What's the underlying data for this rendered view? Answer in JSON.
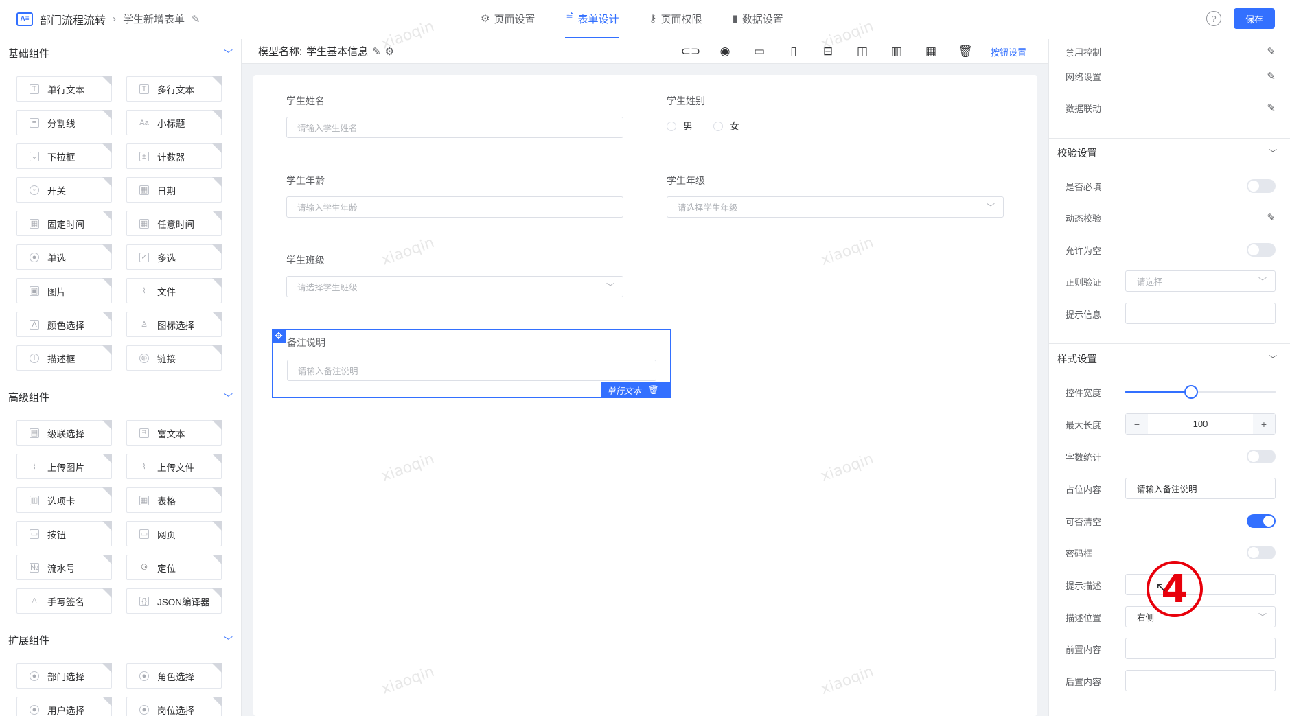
{
  "header": {
    "breadcrumb_root": "部门流程流转",
    "breadcrumb_page": "学生新增表单",
    "tabs": [
      {
        "label": "页面设置",
        "icon": "gear-icon",
        "active": false
      },
      {
        "label": "表单设计",
        "icon": "document-icon",
        "active": true
      },
      {
        "label": "页面权限",
        "icon": "lock-icon",
        "active": false
      },
      {
        "label": "数据设置",
        "icon": "bar-chart-icon",
        "active": false
      }
    ],
    "save_label": "保存"
  },
  "left_panel": {
    "groups": [
      {
        "title": "基础组件",
        "items": [
          "单行文本",
          "多行文本",
          "分割线",
          "小标题",
          "下拉框",
          "计数器",
          "开关",
          "日期",
          "固定时间",
          "任意时间",
          "单选",
          "多选",
          "图片",
          "文件",
          "颜色选择",
          "图标选择",
          "描述框",
          "链接"
        ]
      },
      {
        "title": "高级组件",
        "items": [
          "级联选择",
          "富文本",
          "上传图片",
          "上传文件",
          "选项卡",
          "表格",
          "按钮",
          "网页",
          "流水号",
          "定位",
          "手写签名",
          "JSON编译器"
        ]
      },
      {
        "title": "扩展组件",
        "items": [
          "部门选择",
          "角色选择",
          "用户选择",
          "岗位选择"
        ]
      }
    ]
  },
  "center": {
    "model_label": "模型名称:",
    "model_name": "学生基本信息",
    "button_settings": "按钮设置",
    "toolbar_icons": [
      "link-icon",
      "eye-icon",
      "pc-layout-icon",
      "mobile-layout-icon",
      "one-column-icon",
      "two-column-icon",
      "three-column-icon",
      "four-column-icon",
      "trash-icon"
    ],
    "fields": {
      "name": {
        "label": "学生姓名",
        "placeholder": "请输入学生姓名"
      },
      "gender": {
        "label": "学生姓别",
        "options": [
          "男",
          "女"
        ]
      },
      "age": {
        "label": "学生年龄",
        "placeholder": "请输入学生年龄"
      },
      "grade": {
        "label": "学生年级",
        "placeholder": "请选择学生年级"
      },
      "class": {
        "label": "学生班级",
        "placeholder": "请选择学生班级"
      },
      "remark": {
        "label": "备注说明",
        "placeholder": "请输入备注说明",
        "type_tag": "单行文本"
      }
    },
    "watermark": "xiaoqin"
  },
  "right_panel": {
    "top_rows": [
      "禁用控制",
      "网络设置",
      "数据联动"
    ],
    "validation": {
      "title": "校验设置",
      "required": "是否必填",
      "dynamic": "动态校验",
      "allow_empty": "允许为空",
      "regex": "正则验证",
      "regex_placeholder": "请选择",
      "tip": "提示信息"
    },
    "style": {
      "title": "样式设置",
      "width": "控件宽度",
      "width_fraction": 0.44,
      "max_length": "最大长度",
      "max_length_value": "100",
      "word_count": "字数统计",
      "placeholder_label": "占位内容",
      "placeholder_value": "请输入备注说明",
      "clearable": "可否清空",
      "clearable_on": true,
      "password": "密码框",
      "hint": "提示描述",
      "hint_position": "描述位置",
      "hint_position_value": "右侧",
      "prefix": "前置内容",
      "suffix": "后置内容"
    }
  },
  "annotation": "4",
  "colors": {
    "accent": "#3370ff",
    "annotation": "#e8000b"
  }
}
